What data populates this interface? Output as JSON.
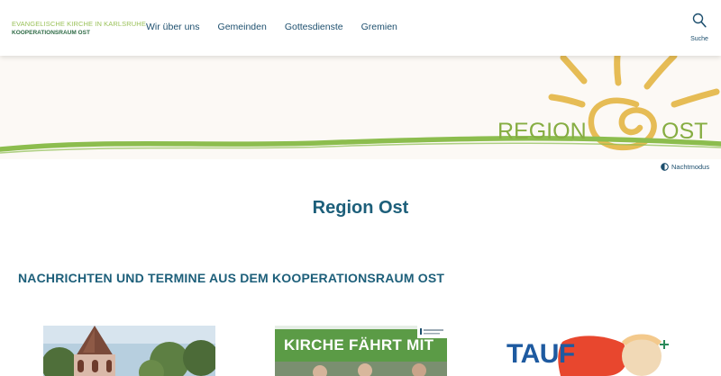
{
  "brand": {
    "line1": "EVANGELISCHE KIRCHE IN KARLSRUHE",
    "line2": "KOOPERATIONSRAUM OST"
  },
  "nav": {
    "items": [
      {
        "label": "Wir über uns"
      },
      {
        "label": "Gemeinden"
      },
      {
        "label": "Gottesdienste"
      },
      {
        "label": "Gremien"
      }
    ]
  },
  "search": {
    "label": "Suche",
    "icon": "search-icon"
  },
  "hero": {
    "logo_left": "REGION",
    "logo_right": "OST",
    "colors": {
      "sun": "#e6bc55",
      "wave": "#8cbd4e",
      "text": "#86ad42"
    }
  },
  "night_mode": {
    "label": "Nachtmodus",
    "icon": "half-circle-icon"
  },
  "page": {
    "title": "Region Ost"
  },
  "news": {
    "heading": "NACHRICHTEN UND TERMINE AUS DEM KOOPERATIONSRAUM OST",
    "cards": [
      {
        "image": "church-tower-photo"
      },
      {
        "image": "kirche-faehrt-mit-poster",
        "text": "KIRCHE FÄHRT MIT"
      },
      {
        "image": "tauf-poster",
        "text": "TAUF"
      }
    ]
  }
}
